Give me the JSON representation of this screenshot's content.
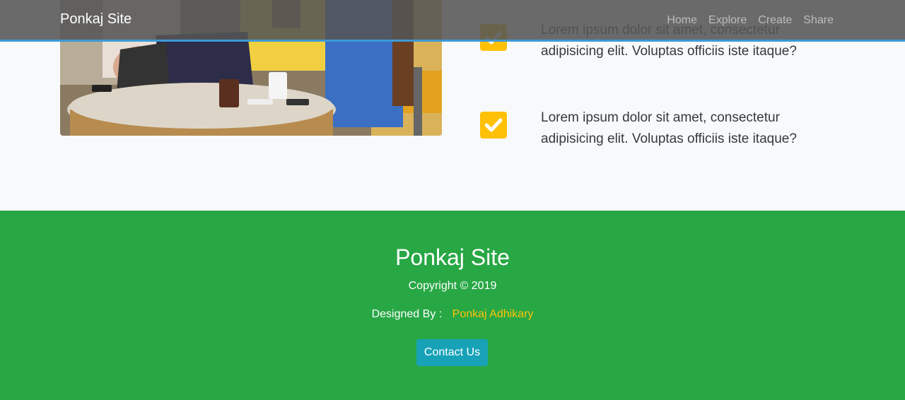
{
  "navbar": {
    "brand": "Ponkaj Site",
    "links": [
      "Home",
      "Explore",
      "Create",
      "Share"
    ]
  },
  "features": {
    "photo_icon": "people-at-table-photo",
    "check_icon": "check-icon",
    "items": [
      "Lorem ipsum dolor sit amet, consectetur adipisicing elit. Voluptas officiis iste itaque?",
      "Lorem ipsum dolor sit amet, consectetur adipisicing elit. Voluptas officiis iste itaque?"
    ]
  },
  "footer": {
    "title": "Ponkaj Site",
    "copyright": "Copyright © 2019",
    "designed_by_label": "Designed By :",
    "designer": "Ponkaj Adhikary",
    "contact_label": "Contact Us"
  },
  "colors": {
    "navbar_bg": "#555555",
    "navbar_border": "#3c9ad6",
    "check_bg": "#ffc107",
    "footer_bg": "#28a745",
    "designer_text": "#ffc107",
    "contact_button": "#17a2b8"
  }
}
